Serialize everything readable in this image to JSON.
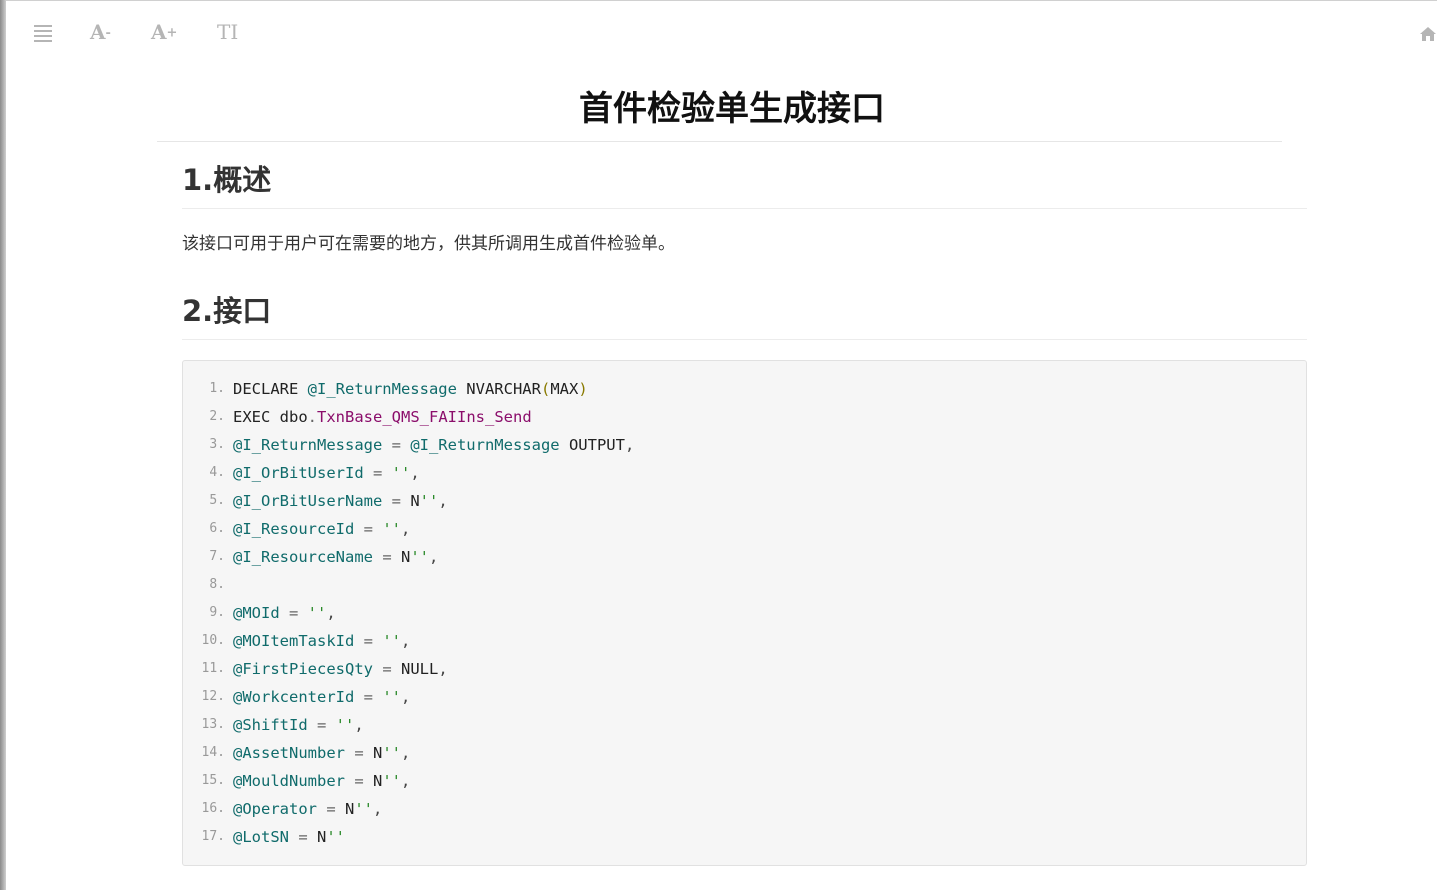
{
  "toolbar": {
    "font_decrease": "A",
    "font_decrease_sign": "-",
    "font_increase": "A",
    "font_increase_sign": "+",
    "theme": "TI"
  },
  "page": {
    "title": "首件检验单生成接口"
  },
  "sections": [
    {
      "heading": "1.概述",
      "paragraph": "该接口可用于用户可在需要的地方，供其所调用生成首件检验单。"
    },
    {
      "heading": "2.接口"
    }
  ],
  "code": {
    "lines": [
      {
        "num": "1.",
        "tokens": [
          [
            "kw",
            "DECLARE "
          ],
          [
            "var",
            "@I_ReturnMessage"
          ],
          [
            "plain",
            " NVARCHAR"
          ],
          [
            "paren",
            "("
          ],
          [
            "plain",
            "MAX"
          ],
          [
            "paren",
            ")"
          ]
        ]
      },
      {
        "num": "2.",
        "tokens": [
          [
            "kw",
            "EXEC "
          ],
          [
            "plain",
            "dbo"
          ],
          [
            "op",
            "."
          ],
          [
            "fn",
            "TxnBase_QMS_FAIIns_Send"
          ]
        ]
      },
      {
        "num": "3.",
        "tokens": [
          [
            "var",
            "@I_ReturnMessage"
          ],
          [
            "op",
            " = "
          ],
          [
            "var",
            "@I_ReturnMessage"
          ],
          [
            "plain",
            " OUTPUT"
          ],
          [
            "punc",
            ","
          ]
        ]
      },
      {
        "num": "4.",
        "tokens": [
          [
            "var",
            "@I_OrBitUserId"
          ],
          [
            "op",
            " = "
          ],
          [
            "str",
            "''"
          ],
          [
            "punc",
            ","
          ]
        ]
      },
      {
        "num": "5.",
        "tokens": [
          [
            "var",
            "@I_OrBitUserName"
          ],
          [
            "op",
            " = "
          ],
          [
            "plain",
            "N"
          ],
          [
            "str",
            "''"
          ],
          [
            "punc",
            ","
          ]
        ]
      },
      {
        "num": "6.",
        "tokens": [
          [
            "var",
            "@I_ResourceId"
          ],
          [
            "op",
            " = "
          ],
          [
            "str",
            "''"
          ],
          [
            "punc",
            ","
          ]
        ]
      },
      {
        "num": "7.",
        "tokens": [
          [
            "var",
            "@I_ResourceName"
          ],
          [
            "op",
            " = "
          ],
          [
            "plain",
            "N"
          ],
          [
            "str",
            "''"
          ],
          [
            "punc",
            ","
          ]
        ]
      },
      {
        "num": "8.",
        "tokens": []
      },
      {
        "num": "9.",
        "tokens": [
          [
            "var",
            "@MOId"
          ],
          [
            "op",
            " = "
          ],
          [
            "str",
            "''"
          ],
          [
            "punc",
            ","
          ]
        ]
      },
      {
        "num": "10.",
        "tokens": [
          [
            "var",
            "@MOItemTaskId"
          ],
          [
            "op",
            " = "
          ],
          [
            "str",
            "''"
          ],
          [
            "punc",
            ","
          ]
        ]
      },
      {
        "num": "11.",
        "tokens": [
          [
            "var",
            "@FirstPiecesQty"
          ],
          [
            "op",
            " = "
          ],
          [
            "plain",
            "NULL"
          ],
          [
            "punc",
            ","
          ]
        ]
      },
      {
        "num": "12.",
        "tokens": [
          [
            "var",
            "@WorkcenterId"
          ],
          [
            "op",
            " = "
          ],
          [
            "str",
            "''"
          ],
          [
            "punc",
            ","
          ]
        ]
      },
      {
        "num": "13.",
        "tokens": [
          [
            "var",
            "@ShiftId"
          ],
          [
            "op",
            " = "
          ],
          [
            "str",
            "''"
          ],
          [
            "punc",
            ","
          ]
        ]
      },
      {
        "num": "14.",
        "tokens": [
          [
            "var",
            "@AssetNumber"
          ],
          [
            "op",
            " = "
          ],
          [
            "plain",
            "N"
          ],
          [
            "str",
            "''"
          ],
          [
            "punc",
            ","
          ]
        ]
      },
      {
        "num": "15.",
        "tokens": [
          [
            "var",
            "@MouldNumber"
          ],
          [
            "op",
            " = "
          ],
          [
            "plain",
            "N"
          ],
          [
            "str",
            "''"
          ],
          [
            "punc",
            ","
          ]
        ]
      },
      {
        "num": "16.",
        "tokens": [
          [
            "var",
            "@Operator"
          ],
          [
            "op",
            " = "
          ],
          [
            "plain",
            "N"
          ],
          [
            "str",
            "''"
          ],
          [
            "punc",
            ","
          ]
        ]
      },
      {
        "num": "17.",
        "tokens": [
          [
            "var",
            "@LotSN"
          ],
          [
            "op",
            " = "
          ],
          [
            "plain",
            "N"
          ],
          [
            "str",
            "''"
          ]
        ]
      }
    ]
  },
  "colors": {
    "variable": "#106b6b",
    "procedure": "#8b0e6b",
    "string": "#2a8a2a",
    "toolbar_icon": "#b5b5b5"
  }
}
